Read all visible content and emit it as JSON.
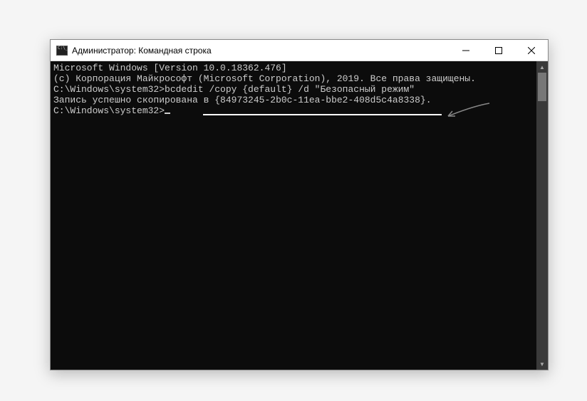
{
  "window": {
    "title": "Администратор: Командная строка"
  },
  "console": {
    "lines": {
      "version": "Microsoft Windows [Version 10.0.18362.476]",
      "copyright": "(c) Корпорация Майкрософт (Microsoft Corporation), 2019. Все права защищены.",
      "blank1": "",
      "prompt1_path": "C:\\Windows\\system32>",
      "prompt1_cmd": "bcdedit /copy {default} /d \"Безопасный режим\"",
      "result_prefix": "Запись успешно скопирована в ",
      "result_guid": "{84973245-2b0c-11ea-bbe2-408d5c4a8338}",
      "result_suffix": ".",
      "blank2": "",
      "prompt2_path": "C:\\Windows\\system32>"
    }
  }
}
